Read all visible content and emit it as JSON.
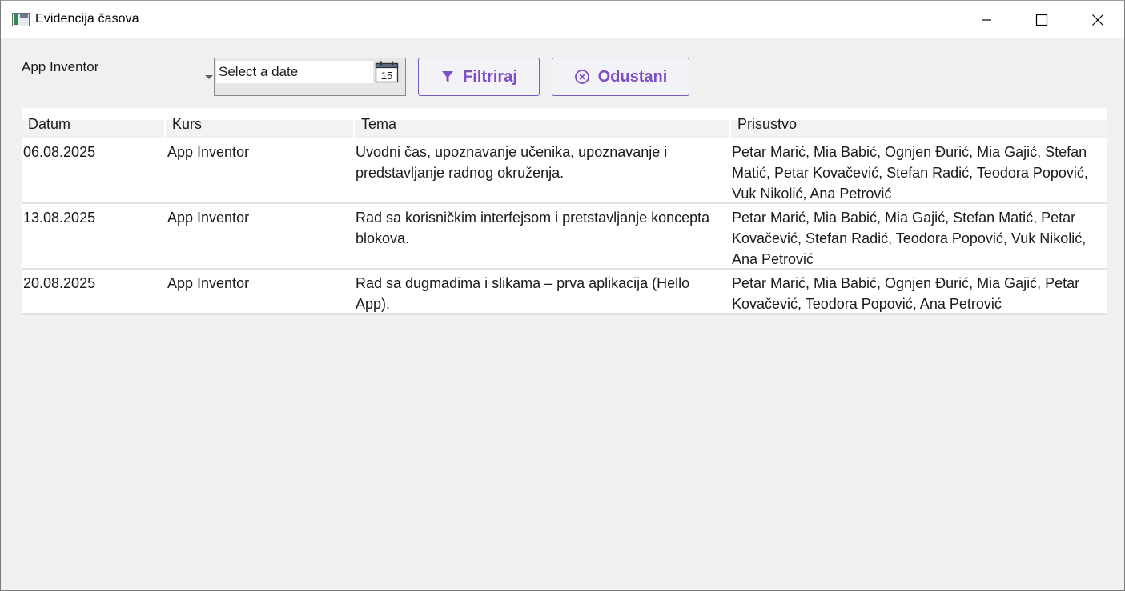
{
  "window": {
    "title": "Evidencija časova"
  },
  "toolbar": {
    "course_selected": "App Inventor",
    "date_placeholder": "Select a date",
    "calendar_day": "15",
    "filter_label": "Filtriraj",
    "cancel_label": "Odustani"
  },
  "grid": {
    "columns": [
      "Datum",
      "Kurs",
      "Tema",
      "Prisustvo"
    ],
    "rows": [
      {
        "datum": "06.08.2025",
        "kurs": "App Inventor",
        "tema": "Uvodni čas, upoznavanje učenika, upoznavanje i predstavljanje radnog okruženja.",
        "prisustvo": "Petar Marić, Mia Babić, Ognjen Đurić, Mia Gajić, Stefan Matić, Petar Kovačević, Stefan Radić, Teodora Popović, Vuk Nikolić, Ana Petrović"
      },
      {
        "datum": "13.08.2025",
        "kurs": "App Inventor",
        "tema": "Rad sa korisničkim interfejsom i pretstavljanje koncepta blokova.",
        "prisustvo": "Petar Marić, Mia Babić, Mia Gajić, Stefan Matić, Petar Kovačević, Stefan Radić, Teodora Popović, Vuk Nikolić, Ana Petrović"
      },
      {
        "datum": "20.08.2025",
        "kurs": "App Inventor",
        "tema": "Rad sa dugmadima i slikama – prva aplikacija (Hello App).",
        "prisustvo": "Petar Marić, Mia Babić, Ognjen Đurić, Mia Gajić, Petar Kovačević, Teodora Popović, Ana Petrović"
      }
    ]
  },
  "colors": {
    "accent": "#7c4fc4",
    "background": "#f0f0f0",
    "grid_background": "#ffffff"
  },
  "icons": {
    "filter": "funnel-icon",
    "cancel": "circle-x-icon",
    "calendar": "calendar-icon"
  }
}
